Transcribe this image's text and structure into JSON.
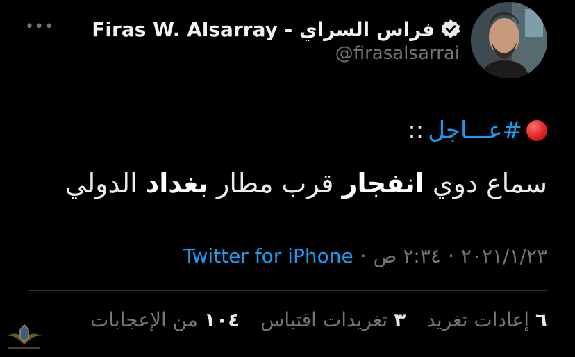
{
  "header": {
    "display_name": "فراس السراي - Firas W. Alsarray",
    "handle": "@firasalsarrai",
    "more_label": "•••",
    "verified_icon": "verified-badge-icon",
    "avatar_icon": "profile-photo"
  },
  "tweet": {
    "hashtag": "#عـــاجل",
    "separator": "::",
    "body_part1": "سماع دوي",
    "body_bold1": "انفجار",
    "body_part2": "قرب مطار",
    "body_bold2": "بغداد",
    "body_part3": "الدولي"
  },
  "meta": {
    "time": "٢:٣٤ ص",
    "date": "٢٠٢١/١/٢٣",
    "dot": "·",
    "source": "Twitter for iPhone"
  },
  "stats": {
    "retweets_count": "٦",
    "retweets_label": "إعادات تغريد",
    "quotes_count": "٣",
    "quotes_label": "تغريدات اقتباس",
    "likes_count": "١٠٤",
    "likes_label": "من الإعجابات"
  },
  "colors": {
    "background": "#000000",
    "link": "#1d9bf0",
    "muted": "#71767b",
    "text": "#e7e9ea"
  }
}
